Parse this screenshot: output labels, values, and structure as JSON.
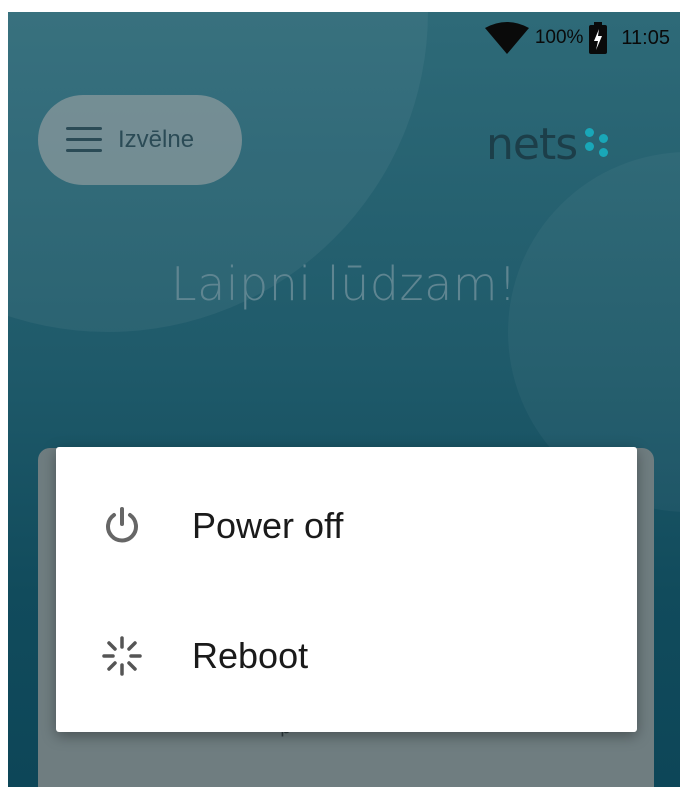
{
  "status_bar": {
    "icons": [
      "wifi-icon",
      "battery-charging-icon"
    ],
    "battery": "100%",
    "time": "11:05"
  },
  "header": {
    "menu_label": "Izvēlne",
    "menu_icon": "hamburger-icon",
    "logo_text": "nets"
  },
  "main": {
    "welcome": "Laipni lūdzam!",
    "background_hint": "p"
  },
  "dialog": {
    "items": [
      {
        "label": "Power off",
        "icon": "power-icon"
      },
      {
        "label": "Reboot",
        "icon": "reboot-icon"
      }
    ]
  },
  "colors": {
    "background_top": "#2e6a78",
    "background_bottom": "#0d4658",
    "logo_dots": "#19a7b8",
    "dialog_bg": "#ffffff",
    "dialog_text": "#1a1a1a"
  }
}
